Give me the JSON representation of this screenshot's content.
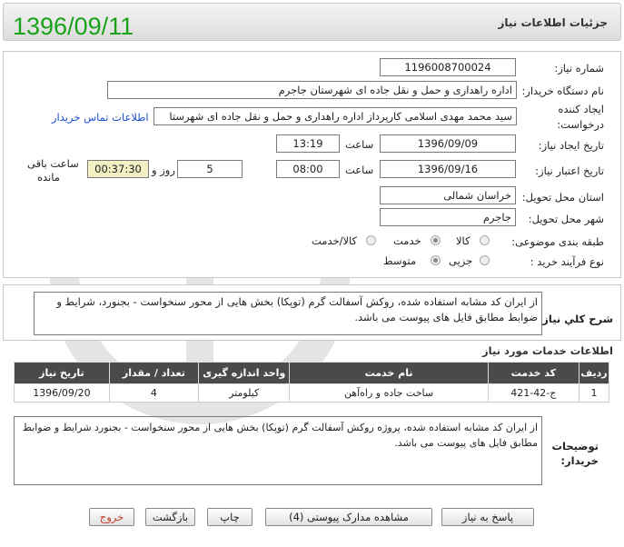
{
  "header": {
    "title": "جزئیات اطلاعات نیاز",
    "date": "1396/09/11"
  },
  "form": {
    "need_number_label": "شماره نیاز:",
    "need_number": "1196008700024",
    "buyer_org_label": "نام دستگاه خریدار:",
    "buyer_org": "اداره راهداری و حمل و نقل جاده ای شهرستان جاجرم",
    "creator_label_1": "ایجاد کننده",
    "creator_label_2": "درخواست:",
    "creator": "سید محمد مهدی اسلامی کارپرداز اداره راهداری و حمل و نقل جاده ای شهرستا",
    "contact_link": "اطلاعات تماس خریدار",
    "created_date_label": "تاریخ ایجاد نیاز:",
    "created_date": "1396/09/09",
    "time_label": "ساعت",
    "created_time": "13:19",
    "validity_label": "تاریخ اعتبار نیاز:",
    "validity_date": "1396/09/16",
    "validity_time": "08:00",
    "days_value": "5",
    "days_label": "روز و",
    "remaining_time": "00:37:30",
    "remaining_label_1": "ساعت باقی",
    "remaining_label_2": "مانده",
    "province_label": "استان محل تحویل:",
    "province": "خراسان شمالی",
    "city_label": "شهر محل تحویل:",
    "city": "جاجرم",
    "category_label": "طبقه بندی موضوعی:",
    "category_options": [
      "کالا",
      "خدمت",
      "کالا/خدمت"
    ],
    "category_selected": "خدمت",
    "process_label": "نوع فرآیند خرید :",
    "process_options": [
      "جزیی",
      "متوسط"
    ],
    "process_selected": "متوسط"
  },
  "summary": {
    "label": "شرح کلي نياز:",
    "text": "از ایران کد مشابه استفاده شده، روکش آسفالت گرم (توپکا) بخش هایی از محور سنخواست - بجنورد، شرایط و ضوابط مطابق فایل های پیوست می باشد."
  },
  "services": {
    "title": "اطلاعات خدمات مورد نیاز",
    "columns": [
      "ردیف",
      "کد خدمت",
      "نام خدمت",
      "واحد اندازه گیری",
      "تعداد / مقدار",
      "تاریخ نیاز"
    ],
    "rows": [
      [
        "1",
        "ج-42-421",
        "ساخت جاده و راه‌آهن",
        "کیلومتر",
        "4",
        "1396/09/20"
      ]
    ]
  },
  "buyer_notes": {
    "label_1": "توضیحات",
    "label_2": "خریدار:",
    "text": "از ایران کد مشابه استفاده شده، پروژه روکش آسفالت گرم (توپکا) بخش هایی از محور سنخواست - بجنورد شرایط و ضوابط مطابق فایل های پیوست می باشد."
  },
  "buttons": {
    "reply": "پاسخ به نیاز",
    "attachments": "مشاهده مدارک پیوستی (4)",
    "print": "چاپ",
    "back": "بازگشت",
    "exit": "خروج"
  },
  "colors": {
    "date_green": "#1aa31a",
    "link_blue": "#1a4fd0",
    "exit_red": "#c0392b",
    "table_header": "#4a4a4a",
    "remaining_bg": "#f3f0c4"
  }
}
